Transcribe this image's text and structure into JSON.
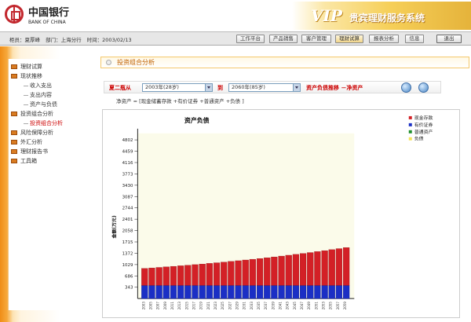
{
  "header": {
    "logo_cn": "中国银行",
    "logo_en": "BANK OF CHINA",
    "banner_vip": "VIP",
    "banner_title": "贵宾理财服务系统"
  },
  "userbar": {
    "manager": "柜员：夏厚峰",
    "department": "部门：上海分行",
    "time": "时间：2003/02/13"
  },
  "nav": [
    {
      "label": "工作平台"
    },
    {
      "label": "产品销售"
    },
    {
      "label": "客户管理"
    },
    {
      "label": "理财试算"
    },
    {
      "label": "报表分析"
    },
    {
      "label": "信息"
    },
    {
      "label": "退出"
    }
  ],
  "sidebar": {
    "items": [
      {
        "label": "理财试算",
        "type": "node"
      },
      {
        "label": "现状推移",
        "type": "node"
      },
      {
        "label": "收入支出",
        "type": "leaf"
      },
      {
        "label": "支出内容",
        "type": "leaf"
      },
      {
        "label": "资产与负债",
        "type": "leaf"
      },
      {
        "label": "投资组合分析",
        "type": "node"
      },
      {
        "label": "投资组合分析",
        "type": "leaf",
        "active": true
      },
      {
        "label": "风险保障分析",
        "type": "node"
      },
      {
        "label": "外汇分析",
        "type": "node"
      },
      {
        "label": "理财报告书",
        "type": "node"
      },
      {
        "label": "工具箱",
        "type": "node"
      }
    ]
  },
  "page": {
    "title": "投资组合分析",
    "query_label": "夏二瓶从",
    "from_value": "2003年(28岁)",
    "to_label": "到",
    "to_value": "2060年(85岁)",
    "mode_label": "资产负债推移 －净资产",
    "formula": "净资产 = [现金储蓄存款 +有价证券 +普通资产 +负债 ]"
  },
  "colors": {
    "cash": "#d32026",
    "securities": "#1b2fc5",
    "general": "#1f8f2d",
    "debt": "#f3e25b",
    "plotbg": "#fbfbea"
  },
  "chart_data": {
    "type": "bar",
    "title": "资产负债",
    "ylabel": "金额(万元)",
    "ylim": [
      0,
      5000
    ],
    "yticks": [
      343,
      686,
      1029,
      1372,
      1715,
      2058,
      2401,
      2744,
      3087,
      3430,
      3773,
      4116,
      4459,
      4802
    ],
    "categories": [
      "2003",
      "2005",
      "2007",
      "2009",
      "2011",
      "2013",
      "2015",
      "2017",
      "2019",
      "2021",
      "2023",
      "2025",
      "2027",
      "2029",
      "2031",
      "2033",
      "2035",
      "2037",
      "2039",
      "2041",
      "2043",
      "2045",
      "2047",
      "2049",
      "2051",
      "2053",
      "2055",
      "2057",
      "2059"
    ],
    "series": [
      {
        "name": "现金存款",
        "values": [
          515,
          530,
          545,
          562,
          578,
          595,
          612,
          630,
          648,
          667,
          686,
          706,
          727,
          748,
          770,
          792,
          815,
          839,
          863,
          888,
          914,
          940,
          967,
          995,
          1024,
          1053,
          1083,
          1114,
          1146
        ]
      },
      {
        "name": "有价证券",
        "values": [
          398,
          398,
          398,
          398,
          398,
          398,
          398,
          398,
          398,
          398,
          398,
          398,
          398,
          398,
          398,
          398,
          398,
          398,
          398,
          398,
          398,
          398,
          398,
          398,
          398,
          398,
          398,
          398,
          398
        ]
      },
      {
        "name": "普通资产",
        "values": [
          0,
          0,
          0,
          0,
          0,
          0,
          0,
          0,
          0,
          0,
          0,
          0,
          0,
          0,
          0,
          0,
          0,
          0,
          0,
          0,
          0,
          0,
          0,
          0,
          0,
          0,
          0,
          0,
          0
        ]
      },
      {
        "name": "负债",
        "values": [
          0,
          0,
          0,
          0,
          0,
          0,
          0,
          0,
          0,
          0,
          0,
          0,
          0,
          0,
          0,
          0,
          0,
          0,
          0,
          0,
          0,
          0,
          0,
          0,
          0,
          0,
          0,
          0,
          0
        ]
      }
    ],
    "legend": "top-right"
  }
}
